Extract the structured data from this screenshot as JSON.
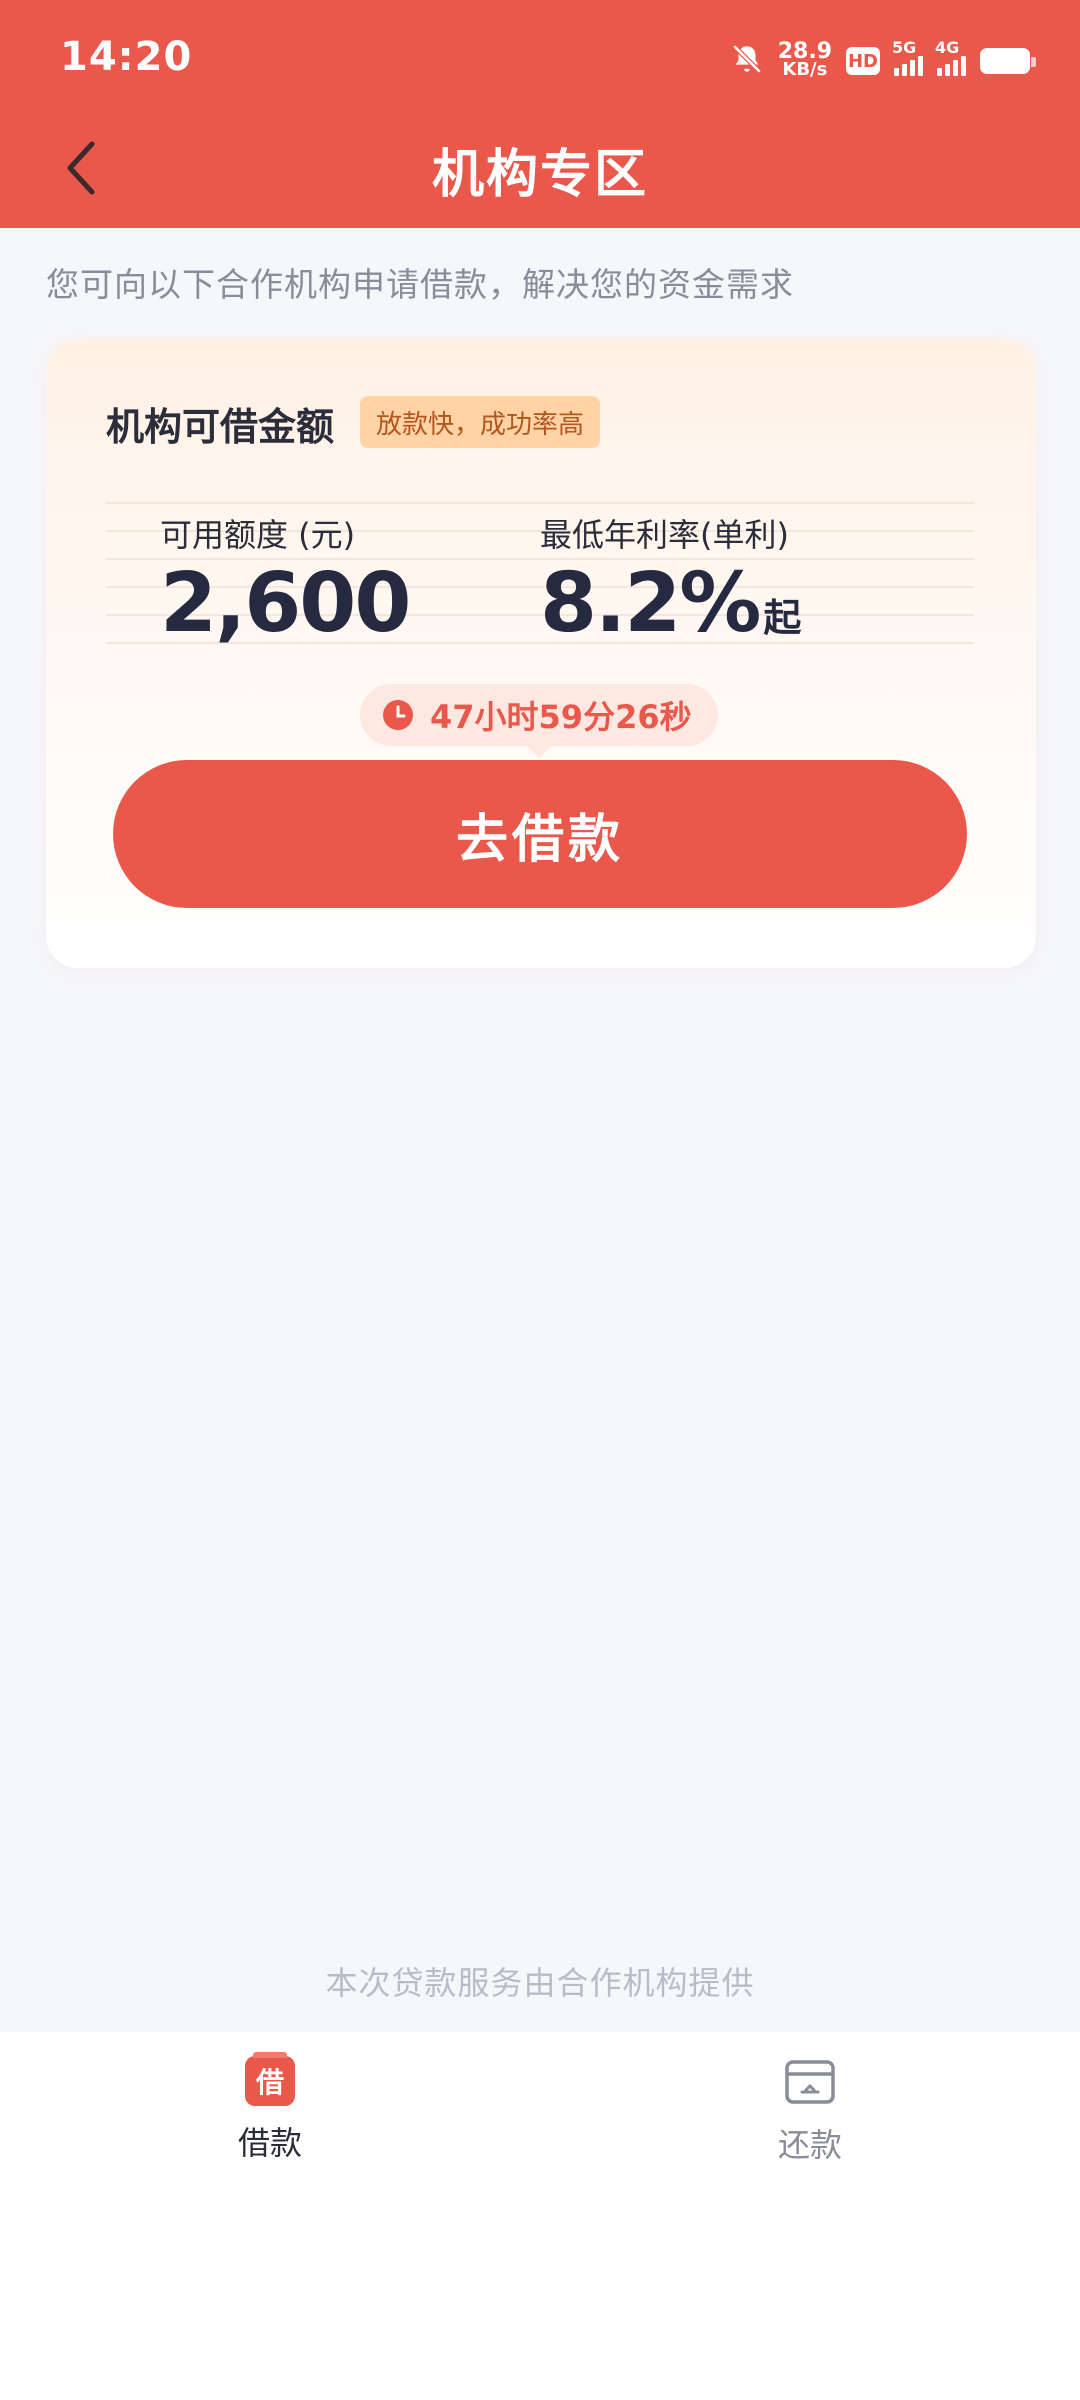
{
  "status_bar": {
    "time": "14:20",
    "net_speed_value": "28.9",
    "net_speed_unit": "KB/s",
    "hd_label": "HD",
    "network_1": "5G",
    "network_2": "4G",
    "icons": [
      "mute-bell-icon",
      "hd-icon",
      "signal-5g-icon",
      "signal-4g-icon",
      "battery-icon"
    ]
  },
  "header": {
    "title": "机构专区",
    "back_icon": "chevron-left-icon"
  },
  "intro_text": "您可向以下合作机构申请借款，解决您的资金需求",
  "card": {
    "title": "机构可借金额",
    "tag": "放款快，成功率高",
    "amount_label": "可用额度 (元)",
    "amount_value": "2,600",
    "rate_label": "最低年利率(单利)",
    "rate_value": "8.2%",
    "rate_suffix": "起",
    "countdown": "47小时59分26秒",
    "button_label": "去借款"
  },
  "footer_note": "本次贷款服务由合作机构提供",
  "tabbar": {
    "items": [
      {
        "label": "借款",
        "icon_text": "借",
        "active": true,
        "icon": "borrow-icon"
      },
      {
        "label": "还款",
        "active": false,
        "icon": "repay-card-icon"
      }
    ]
  },
  "colors": {
    "primary": "#e9584a",
    "text_dark": "#2b2d3a",
    "text_muted": "#8a8d99",
    "tag_bg": "#ffd3a6",
    "tag_text": "#b3561e"
  }
}
